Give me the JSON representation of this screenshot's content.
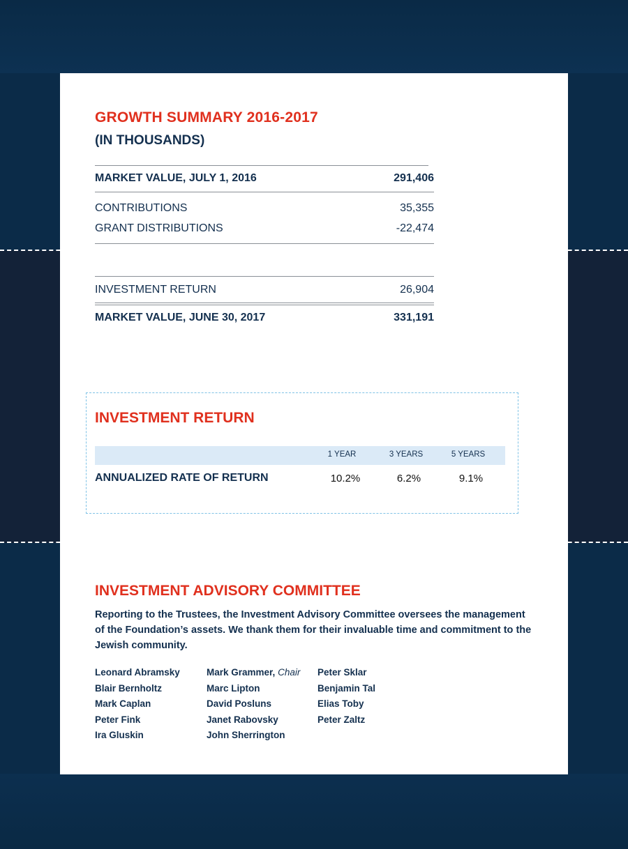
{
  "growth_summary": {
    "title": "GROWTH SUMMARY 2016-2017",
    "subtitle": "(IN THOUSANDS)",
    "rows": [
      {
        "label": "MARKET VALUE, JULY 1, 2016",
        "value": "291,406"
      },
      {
        "label": "CONTRIBUTIONS",
        "value": "35,355"
      },
      {
        "label": "GRANT DISTRIBUTIONS",
        "value": "-22,474"
      },
      {
        "label": "INVESTMENT RETURN",
        "value": "26,904"
      },
      {
        "label": "MARKET VALUE, JUNE 30, 2017",
        "value": "331,191"
      }
    ]
  },
  "investment_return": {
    "title": "INVESTMENT RETURN",
    "columns": [
      "1 YEAR",
      "3 YEARS",
      "5 YEARS"
    ],
    "row_label": "ANNUALIZED RATE OF RETURN",
    "values": [
      "10.2%",
      "6.2%",
      "9.1%"
    ]
  },
  "committee": {
    "title": "INVESTMENT ADVISORY COMMITTEE",
    "description": "Reporting to the Trustees, the Investment Advisory Committee oversees the management of the Foundation’s assets. We thank them for their invaluable time and commitment to the Jewish community.",
    "members": [
      [
        "Leonard Abramsky",
        "Blair Bernholtz",
        "Mark Caplan",
        "Peter Fink",
        "Ira Gluskin"
      ],
      [
        "Mark Grammer,",
        "Marc Lipton",
        "David Posluns",
        "Janet Rabovsky",
        "John Sherrington"
      ],
      [
        "Peter Sklar",
        "Benjamin Tal",
        "Elias Toby",
        "Peter Zaltz"
      ]
    ],
    "chair_role": "Chair"
  },
  "colors": {
    "accent_red": "#e0301e",
    "navy": "#14304f",
    "page_background": "#0b2b48",
    "header_bar": "#dbeaf7",
    "dash_box": "#7fc2e6"
  }
}
